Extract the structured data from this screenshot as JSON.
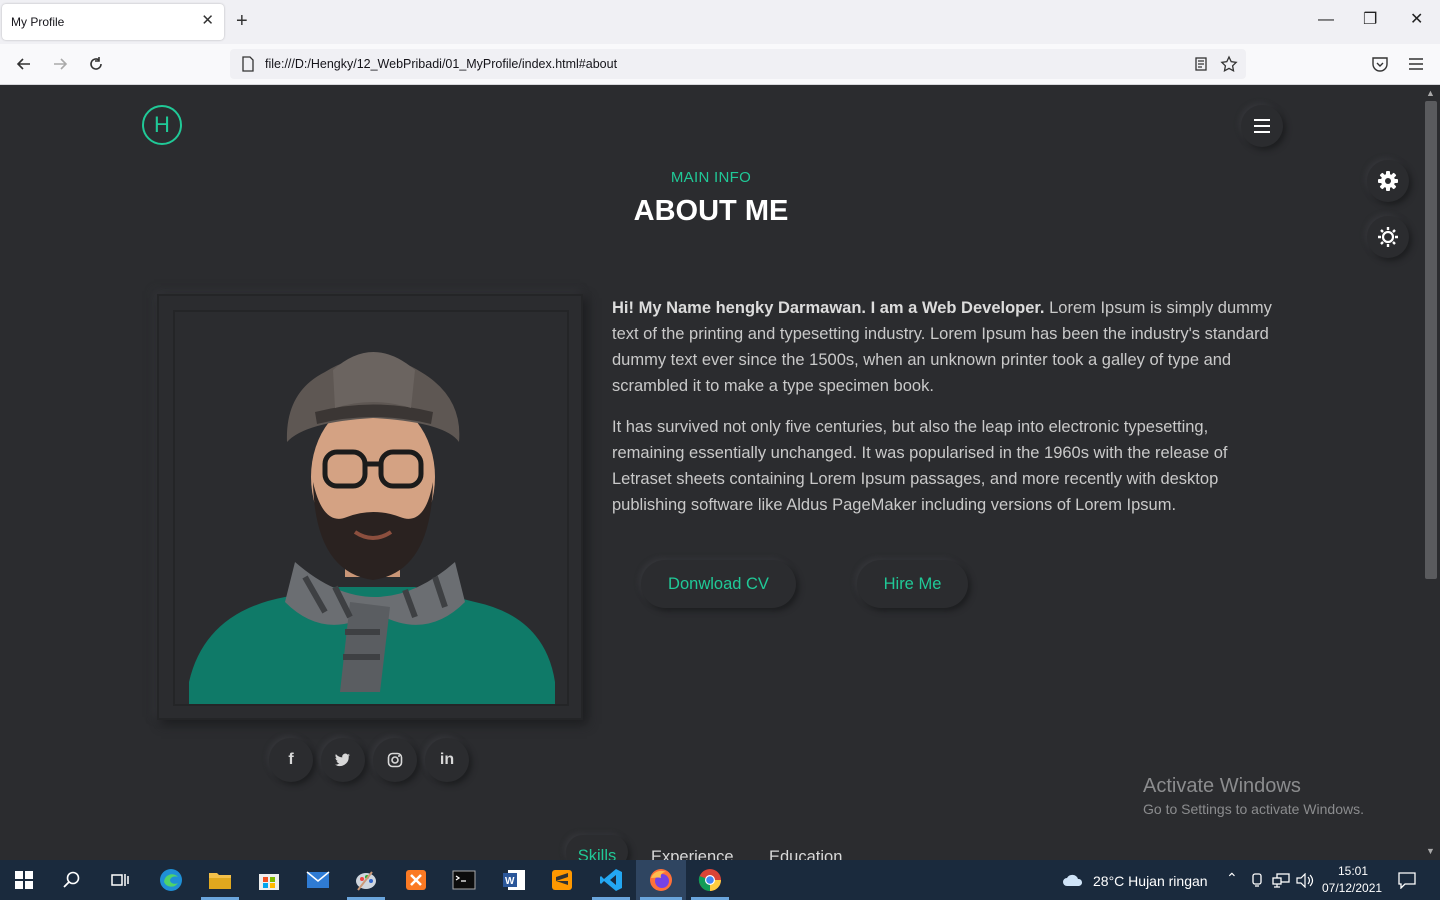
{
  "browser": {
    "tab_title": "My Profile",
    "tab_close": "✕",
    "new_tab": "+",
    "url": "file:///D:/Hengky/12_WebPribadi/01_MyProfile/index.html#about",
    "window_controls": [
      "—",
      "❐",
      "✕"
    ]
  },
  "page": {
    "logo_letter": "H",
    "section_subtitle": "MAIN INFO",
    "section_title": "ABOUT ME",
    "intro_bold": "Hi! My Name hengky Darmawan. I am a Web Developer.",
    "intro_rest": " Lorem Ipsum is simply dummy text of the printing and typesetting industry. Lorem Ipsum has been the industry's standard dummy text ever since the 1500s, when an unknown printer took a galley of type and scrambled it to make a type specimen book.",
    "paragraph2": "It has survived not only five centuries, but also the leap into electronic typesetting, remaining essentially unchanged. It was popularised in the 1960s with the release of Letraset sheets containing Lorem Ipsum passages, and more recently with desktop publishing software like Aldus PageMaker including versions of Lorem Ipsum.",
    "buttons": {
      "download_cv": "Donwload CV",
      "hire_me": "Hire Me"
    },
    "social_icons": [
      "facebook-icon",
      "twitter-icon",
      "instagram-icon",
      "linkedin-icon"
    ],
    "social_glyphs": [
      "f",
      "🐦",
      "◎",
      "in"
    ],
    "tabs": [
      "Skills",
      "Experience",
      "Education"
    ],
    "accent_color": "#20c997",
    "background_color": "#2b2c2f"
  },
  "watermark": {
    "line1": "Activate Windows",
    "line2": "Go to Settings to activate Windows."
  },
  "taskbar": {
    "weather": "28°C  Hujan ringan",
    "time": "15:01",
    "date": "07/12/2021"
  }
}
